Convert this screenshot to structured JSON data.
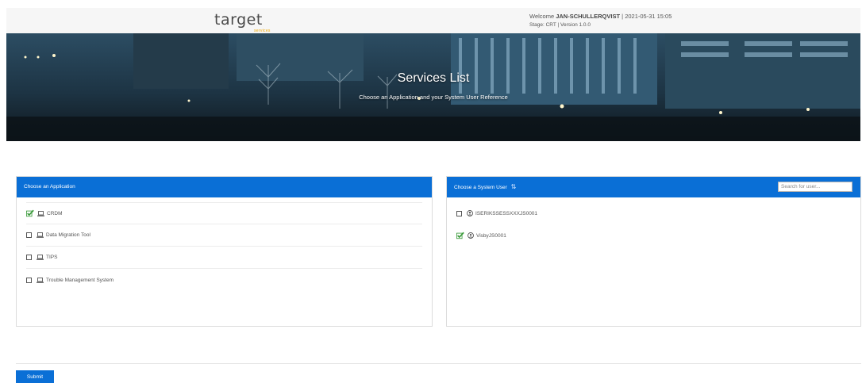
{
  "header": {
    "logo_text": "target",
    "logo_sub": "services",
    "welcome_prefix": "Welcome",
    "user": "JAN-SCHULLERQVIST",
    "datetime": "| 2021-05-31 15:05",
    "stage": "Stage: CRT | Version 1.0.0"
  },
  "hero": {
    "title": "Services List",
    "subtitle": "Choose an Application and your System User Reference"
  },
  "applications": {
    "title": "Choose an Application",
    "items": [
      {
        "label": "CRDM",
        "checked": true
      },
      {
        "label": "Data Migration Tool",
        "checked": false
      },
      {
        "label": "TIPS",
        "checked": false
      },
      {
        "label": "Trouble Management System",
        "checked": false
      }
    ]
  },
  "system_users": {
    "title": "Choose a System User",
    "search_placeholder": "Search for user...",
    "items": [
      {
        "label": "ISERIKSSESSXXXJS0001",
        "checked": false
      },
      {
        "label": "VisbyJS0001",
        "checked": true
      }
    ]
  },
  "footer": {
    "submit_label": "Submit"
  },
  "colors": {
    "accent": "#0a6fd6",
    "check_green": "#3a9a3a"
  }
}
